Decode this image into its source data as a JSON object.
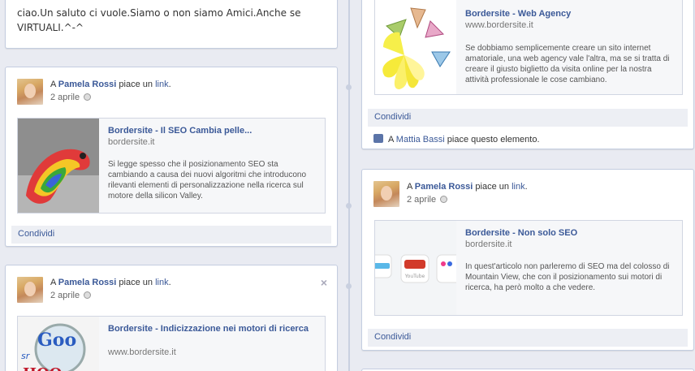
{
  "colors": {
    "link": "#3b5998",
    "background": "#e9ebf2",
    "card_border": "#c4cde0"
  },
  "top_left_post": {
    "text": "ciao.Un saluto ci vuole.Siamo o non siamo Amici.Anche se VIRTUALI.^-^"
  },
  "post_seo_cambia": {
    "prefix": "A",
    "author": "Pamela Rossi",
    "action": "piace un",
    "link_word": "link",
    "period": ".",
    "date": "2 aprile",
    "preview": {
      "title": "Bordersite - Il SEO Cambia pelle...",
      "site": "bordersite.it",
      "description": "Si legge spesso che il posizionamento SEO sta cambiando a causa dei nuovi algoritmi che introducono rilevanti elementi di personalizzazione nella ricerca sul motore della silicon Valley."
    },
    "share_label": "Condividi"
  },
  "post_indicizzazione": {
    "prefix": "A",
    "author": "Pamela Rossi",
    "action": "piace un",
    "link_word": "link",
    "period": ".",
    "date": "2 aprile",
    "close_glyph": "×",
    "preview": {
      "title": "Bordersite - Indicizzazione nei motori di ricerca",
      "site": "www.bordersite.it"
    }
  },
  "post_web_agency": {
    "preview": {
      "title": "Bordersite - Web Agency",
      "site": "www.bordersite.it",
      "description": "Se dobbiamo semplicemente creare un sito internet amatoriale, una web agency vale l'altra, ma se si tratta di creare il giusto biglietto da visita online per la nostra attività professionale le cose cambiano."
    },
    "share_label": "Condividi",
    "like": {
      "prefix": "A",
      "name": "Mattia Bassi",
      "suffix": "piace questo elemento."
    }
  },
  "post_non_solo_seo": {
    "prefix": "A",
    "author": "Pamela Rossi",
    "action": "piace un",
    "link_word": "link",
    "period": ".",
    "date": "2 aprile",
    "preview": {
      "title": "Bordersite - Non solo SEO",
      "site": "bordersite.it",
      "description": "In quest'articolo non parleremo di SEO ma del colosso di Mountain View, che con il posizionamento sui motori di ricerca, ha però molto a che vedere.",
      "icon_labels": [
        "YouTube"
      ]
    },
    "share_label": "Condividi"
  }
}
